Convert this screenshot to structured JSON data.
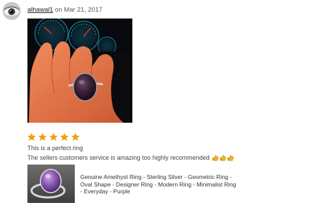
{
  "review": {
    "reviewer_name": "alhawal1",
    "date_text": " on Mar 21, 2017",
    "rating": 5,
    "rating_max": 5,
    "title": "This is a perfect ring",
    "body": "The sellers customers service is amazing too highly recommended"
  },
  "product": {
    "title": "Genuine Amethyst Ring - Sterling Silver - Geometric Ring - Oval Shape - Designer Ring - Modern Ring - Minimalist Ring - Everyday - Purple"
  },
  "colors": {
    "star": "#f1a10b",
    "link_text": "#222222",
    "muted_text": "#595959"
  },
  "icons": [
    "avatar-eye-icon",
    "star-icon",
    "thumbs-up-icon"
  ]
}
